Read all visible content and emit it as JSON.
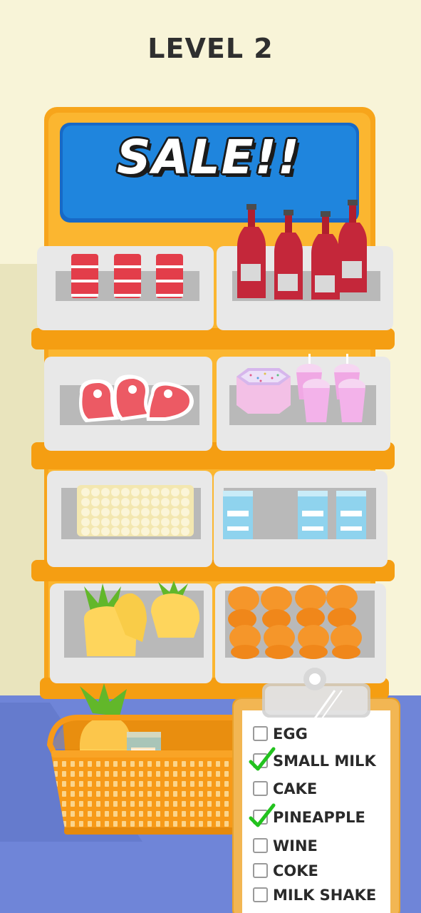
{
  "level": {
    "title": "LEVEL 2"
  },
  "sign": {
    "text": "SALE!!"
  },
  "shelf": {
    "products": [
      {
        "item": "coke",
        "icon": "coke-can-icon"
      },
      {
        "item": "wine",
        "icon": "wine-bottle-icon"
      },
      {
        "item": "steak",
        "icon": "steak-icon"
      },
      {
        "item": "cake",
        "icon": "cake-icon"
      },
      {
        "item": "milk shake",
        "icon": "milkshake-cup-icon"
      },
      {
        "item": "egg",
        "icon": "egg-tray-icon"
      },
      {
        "item": "small milk",
        "icon": "milk-carton-icon"
      },
      {
        "item": "pineapple",
        "icon": "pineapple-icon"
      },
      {
        "item": "orange juice",
        "icon": "orange-jar-icon"
      }
    ]
  },
  "basket": {
    "contents": [
      "pineapple",
      "small milk"
    ]
  },
  "checklist": {
    "items": [
      {
        "label": "EGG",
        "checked": false
      },
      {
        "label": "SMALL MILK",
        "checked": true
      },
      {
        "label": "CAKE",
        "checked": false
      },
      {
        "label": "PINEAPPLE",
        "checked": true
      },
      {
        "label": "WINE",
        "checked": false
      },
      {
        "label": "COKE",
        "checked": false
      },
      {
        "label": "MILK SHAKE",
        "checked": false
      }
    ]
  },
  "colors": {
    "background": "#f8f4d8",
    "floor": "#6f85d8",
    "shelf_frame": "#f8a91b",
    "sign": "#1f7fd6",
    "tray": "#e6e6e6",
    "basket": "#f89a16",
    "check": "#22c21e"
  }
}
